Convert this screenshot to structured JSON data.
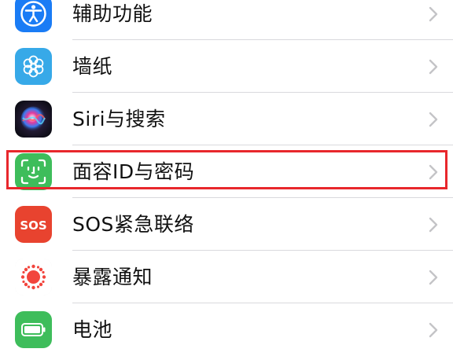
{
  "settings": {
    "items": [
      {
        "label": "辅助功能",
        "icon": "accessibility-icon"
      },
      {
        "label": "墙纸",
        "icon": "wallpaper-flower-icon"
      },
      {
        "label": "Siri与搜索",
        "icon": "siri-icon"
      },
      {
        "label": "面容ID与密码",
        "icon": "face-id-icon"
      },
      {
        "label": "SOS紧急联络",
        "icon": "sos-icon",
        "icon_text": "SOS"
      },
      {
        "label": "暴露通知",
        "icon": "exposure-notification-icon"
      },
      {
        "label": "电池",
        "icon": "battery-icon"
      }
    ]
  },
  "colors": {
    "accessibility": "#1a7cf5",
    "wallpaper": "#37a9e8",
    "face_id": "#3ebd5b",
    "sos": "#e8432f",
    "exposure_bg": "#ffffff",
    "exposure_dots": "#f2453d",
    "battery": "#3ebd5b",
    "highlight": "#e8272c",
    "chevron": "#c4c4c7"
  },
  "highlight": {
    "target": "face-id-row"
  }
}
